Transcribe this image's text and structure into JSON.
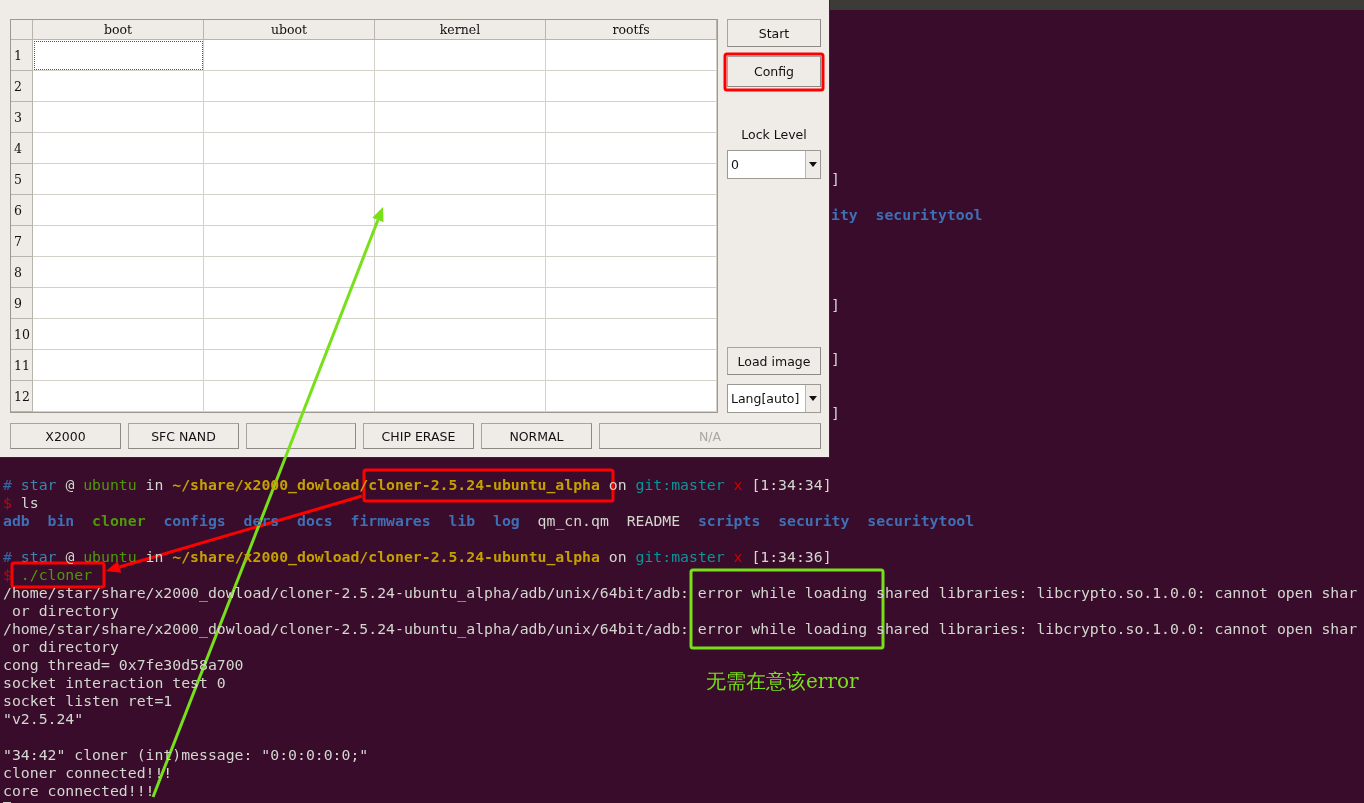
{
  "cloner_window": {
    "table": {
      "columns": [
        "boot",
        "uboot",
        "kernel",
        "rootfs"
      ],
      "rows": [
        {
          "label": "1",
          "focused": true
        },
        {
          "label": "2",
          "focused": false
        },
        {
          "label": "3",
          "focused": false
        },
        {
          "label": "4",
          "focused": false
        },
        {
          "label": "5",
          "focused": false
        },
        {
          "label": "6",
          "focused": false
        },
        {
          "label": "7",
          "focused": false
        },
        {
          "label": "8",
          "focused": false
        },
        {
          "label": "9",
          "focused": false
        },
        {
          "label": "10",
          "focused": false
        },
        {
          "label": "11",
          "focused": false
        },
        {
          "label": "12",
          "focused": false
        }
      ]
    },
    "side_panel": {
      "start_button": "Start",
      "config_button": "Config",
      "lock_level": {
        "label": "Lock Level",
        "value": "0"
      },
      "load_button": "Load image",
      "language": {
        "value": "Lang[auto]"
      }
    },
    "status_buttons": [
      {
        "kind": "label",
        "label": "X2000",
        "disabled": false
      },
      {
        "kind": "label",
        "label": "SFC NAND",
        "disabled": false
      },
      {
        "kind": "blank"
      },
      {
        "kind": "label",
        "label": "CHIP ERASE",
        "disabled": false
      },
      {
        "kind": "label",
        "label": "NORMAL",
        "disabled": false
      },
      {
        "kind": "label",
        "label": "N/A",
        "disabled": true
      }
    ]
  },
  "terminal": {
    "lines": [
      {
        "kind": "fragment",
        "segments": [
          {
            "kind": "text",
            "text": "]"
          }
        ]
      },
      {
        "kind": "blank"
      },
      {
        "kind": "fragment",
        "segments": [
          {
            "kind": "dir",
            "text": "ity  securitytool"
          }
        ]
      },
      {
        "kind": "blank"
      },
      {
        "kind": "blank"
      },
      {
        "kind": "blank"
      },
      {
        "kind": "blank"
      },
      {
        "kind": "fragment",
        "segments": [
          {
            "kind": "text",
            "text": "]"
          }
        ]
      },
      {
        "kind": "blank"
      },
      {
        "kind": "blank"
      },
      {
        "kind": "fragment",
        "segments": [
          {
            "kind": "text",
            "text": "]"
          }
        ]
      },
      {
        "kind": "blank"
      },
      {
        "kind": "blank"
      },
      {
        "kind": "fragment",
        "segments": [
          {
            "kind": "text",
            "text": "]"
          }
        ]
      },
      {
        "kind": "blank"
      },
      {
        "kind": "blank"
      },
      {
        "kind": "blank"
      },
      {
        "kind": "text",
        "segments": [
          {
            "kind": "hash",
            "text": "#"
          },
          {
            "kind": "user",
            "text": " star"
          },
          {
            "kind": "text",
            "text": " @ "
          },
          {
            "kind": "host",
            "text": "ubuntu"
          },
          {
            "kind": "text",
            "text": " in "
          },
          {
            "kind": "path",
            "text": "~/share/x2000_dowload/cloner-2.5.24-ubuntu_alpha"
          },
          {
            "kind": "text",
            "text": " on "
          },
          {
            "kind": "git",
            "text": "git:master"
          },
          {
            "kind": "dirty",
            "text": " x"
          },
          {
            "kind": "text",
            "text": " [1:34:34]"
          }
        ]
      },
      {
        "kind": "text",
        "segments": [
          {
            "kind": "dollar",
            "text": "$"
          },
          {
            "kind": "text",
            "text": " ls"
          }
        ]
      },
      {
        "kind": "text",
        "segments": [
          {
            "kind": "dir",
            "text": "adb"
          },
          {
            "kind": "dir",
            "text": "  bin"
          },
          {
            "kind": "exe",
            "text": "  cloner"
          },
          {
            "kind": "dir",
            "text": "  configs"
          },
          {
            "kind": "dir",
            "text": "  ders"
          },
          {
            "kind": "dir",
            "text": "  docs"
          },
          {
            "kind": "dir",
            "text": "  firmwares"
          },
          {
            "kind": "dir",
            "text": "  lib"
          },
          {
            "kind": "dir",
            "text": "  log"
          },
          {
            "kind": "text",
            "text": "  qm_cn.qm"
          },
          {
            "kind": "text",
            "text": "  README"
          },
          {
            "kind": "dir",
            "text": "  scripts"
          },
          {
            "kind": "dir",
            "text": "  security"
          },
          {
            "kind": "dir",
            "text": "  securitytool"
          }
        ]
      },
      {
        "kind": "blank"
      },
      {
        "kind": "text",
        "segments": [
          {
            "kind": "hash",
            "text": "#"
          },
          {
            "kind": "user",
            "text": " star"
          },
          {
            "kind": "text",
            "text": " @ "
          },
          {
            "kind": "host",
            "text": "ubuntu"
          },
          {
            "kind": "text",
            "text": " in "
          },
          {
            "kind": "path",
            "text": "~/share/x2000_dowload/cloner-2.5.24-ubuntu_alpha"
          },
          {
            "kind": "text",
            "text": " on "
          },
          {
            "kind": "git",
            "text": "git:master"
          },
          {
            "kind": "dirty",
            "text": " x"
          },
          {
            "kind": "text",
            "text": " [1:34:36]"
          }
        ]
      },
      {
        "kind": "text",
        "segments": [
          {
            "kind": "dollar",
            "text": "$"
          },
          {
            "kind": "command",
            "text": " ./cloner"
          }
        ]
      },
      {
        "kind": "text",
        "segments": [
          {
            "kind": "text",
            "text": "/home/star/share/x2000_dowload/cloner-2.5.24-ubuntu_alpha/adb/unix/64bit/adb: error while loading shared libraries: libcrypto.so.1.0.0: cannot open shar"
          }
        ]
      },
      {
        "kind": "text",
        "segments": [
          {
            "kind": "text",
            "text": " or directory"
          }
        ]
      },
      {
        "kind": "text",
        "segments": [
          {
            "kind": "text",
            "text": "/home/star/share/x2000_dowload/cloner-2.5.24-ubuntu_alpha/adb/unix/64bit/adb: error while loading shared libraries: libcrypto.so.1.0.0: cannot open shar"
          }
        ]
      },
      {
        "kind": "text",
        "segments": [
          {
            "kind": "text",
            "text": " or directory"
          }
        ]
      },
      {
        "kind": "text",
        "segments": [
          {
            "kind": "text",
            "text": "cong thread= 0x7fe30d58a700"
          }
        ]
      },
      {
        "kind": "text",
        "segments": [
          {
            "kind": "text",
            "text": "socket interaction test 0"
          }
        ]
      },
      {
        "kind": "text",
        "segments": [
          {
            "kind": "text",
            "text": "socket listen ret=1"
          }
        ]
      },
      {
        "kind": "text",
        "segments": [
          {
            "kind": "text",
            "text": "\"v2.5.24\""
          }
        ]
      },
      {
        "kind": "blank"
      },
      {
        "kind": "text",
        "segments": [
          {
            "kind": "text",
            "text": "\"34:42\" cloner (int)message: \"0:0:0:0:0;\""
          }
        ]
      },
      {
        "kind": "text",
        "segments": [
          {
            "kind": "text",
            "text": "cloner connected!!!"
          }
        ]
      },
      {
        "kind": "text",
        "segments": [
          {
            "kind": "text",
            "text": "core connected!!!"
          }
        ]
      },
      {
        "kind": "cursor"
      }
    ]
  },
  "annotations": [
    {
      "kind": "box",
      "color": "#ff0000"
    },
    {
      "kind": "box",
      "color": "#ff0000"
    },
    {
      "kind": "box",
      "color": "#ff0000"
    },
    {
      "kind": "box",
      "color": "#77e01a"
    },
    {
      "kind": "arrow",
      "color": "#ff0000"
    },
    {
      "kind": "arrow",
      "color": "#77e01a"
    },
    {
      "kind": "note",
      "text": "无需在意该error",
      "color": "#77e01a"
    }
  ]
}
